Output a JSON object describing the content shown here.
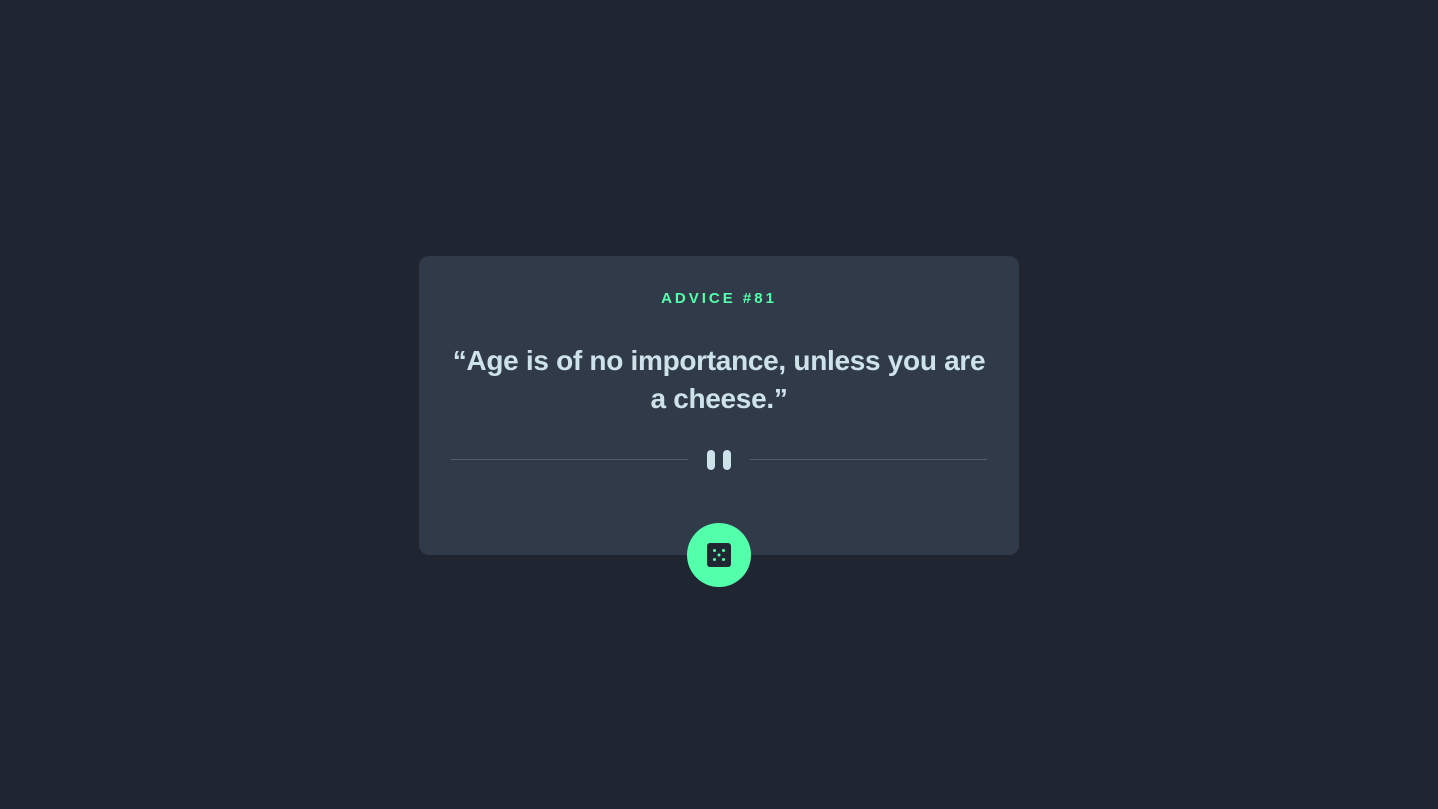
{
  "advice": {
    "label": "ADVICE #81",
    "quote": "“Age is of no importance, unless you are a cheese.”"
  },
  "icons": {
    "divider": "pause-icon",
    "button": "dice-icon"
  },
  "colors": {
    "background": "#1f2632",
    "card": "#313a49",
    "accent": "#53ffaa",
    "text": "#cee3e9",
    "divider": "#4f5d74"
  }
}
